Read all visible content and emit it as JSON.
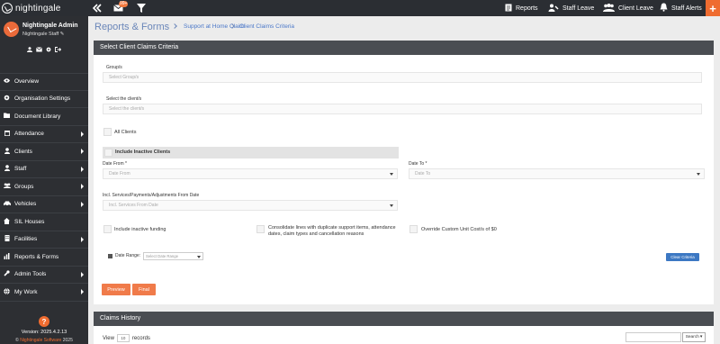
{
  "app": {
    "logo_text": "nightingale"
  },
  "topbar": {
    "mail_count": "99+",
    "links": [
      {
        "label": "Reports",
        "icon": "reports-icon"
      },
      {
        "label": "Staff Leave",
        "icon": "staff-leave-icon"
      },
      {
        "label": "Client Leave",
        "icon": "client-leave-icon"
      },
      {
        "label": "Staff Alerts",
        "icon": "bell-icon"
      }
    ]
  },
  "profile": {
    "name": "Nightingale Admin",
    "role": "Nightingale Staff"
  },
  "sidebar": {
    "items": [
      {
        "label": "Overview",
        "icon": "eye-icon",
        "arrow": false
      },
      {
        "label": "Organisation Settings",
        "icon": "gear-icon",
        "arrow": false
      },
      {
        "label": "Document Library",
        "icon": "folder-icon",
        "arrow": false
      },
      {
        "label": "Attendance",
        "icon": "calendar-icon",
        "arrow": true
      },
      {
        "label": "Clients",
        "icon": "user-icon",
        "arrow": true
      },
      {
        "label": "Staff",
        "icon": "staff-icon",
        "arrow": true
      },
      {
        "label": "Groups",
        "icon": "groups-icon",
        "arrow": true
      },
      {
        "label": "Vehicles",
        "icon": "car-icon",
        "arrow": true
      },
      {
        "label": "SIL Houses",
        "icon": "home-icon",
        "arrow": false
      },
      {
        "label": "Facilities",
        "icon": "building-icon",
        "arrow": true
      },
      {
        "label": "Reports & Forms",
        "icon": "chart-icon",
        "arrow": false
      },
      {
        "label": "Admin Tools",
        "icon": "wrench-icon",
        "arrow": true
      },
      {
        "label": "My Work",
        "icon": "globe-icon",
        "arrow": true
      }
    ],
    "version": "Version: 2025.4.2.13",
    "copyright_prefix": "©",
    "copyright_brand": "Nightingale Software",
    "copyright_year": "2025"
  },
  "header": {
    "title": "Reports & Forms",
    "breadcrumb": [
      "Support at Home Claim",
      "Client Claims Criteria"
    ]
  },
  "criteria": {
    "panel_title": "Select Client Claims Criteria",
    "groups_label": "Group/s",
    "groups_placeholder": "Select Group/s",
    "clients_label": "Select the client/s",
    "clients_placeholder": "Select the client/s",
    "all_clients_label": "All Clients",
    "include_inactive_clients_label": "Include Inactive Clients",
    "date_from_label": "Date From *",
    "date_from_placeholder": "Date From",
    "date_to_label": "Date To *",
    "date_to_placeholder": "Date To",
    "incl_services_label": "Incl. Services/Payments/Adjustments From Date",
    "incl_services_placeholder": "Incl. Services From Date",
    "include_inactive_funding_label": "Include inactive funding",
    "consolidate_label": "Consolidate lines with duplicate support items, attendance dates, claim types and cancellation reasons",
    "override_label": "Override Custom Unit Cost/s of $0",
    "date_range_label": "Date Range:",
    "date_range_placeholder": "Select Date Range",
    "clear_criteria_label": "Clear Criteria",
    "preview_label": "Preview",
    "final_label": "Final"
  },
  "history": {
    "panel_title": "Claims History",
    "view_label": "View",
    "view_value": "10",
    "records_label": "records",
    "search_label": "Search"
  },
  "colors": {
    "accent": "#ef6c30",
    "topbar": "#2b2e33",
    "sidebar": "#2d2f33",
    "panel_header": "#4a4d52",
    "link": "#4a77c8",
    "button_blue": "#3c78c3"
  }
}
